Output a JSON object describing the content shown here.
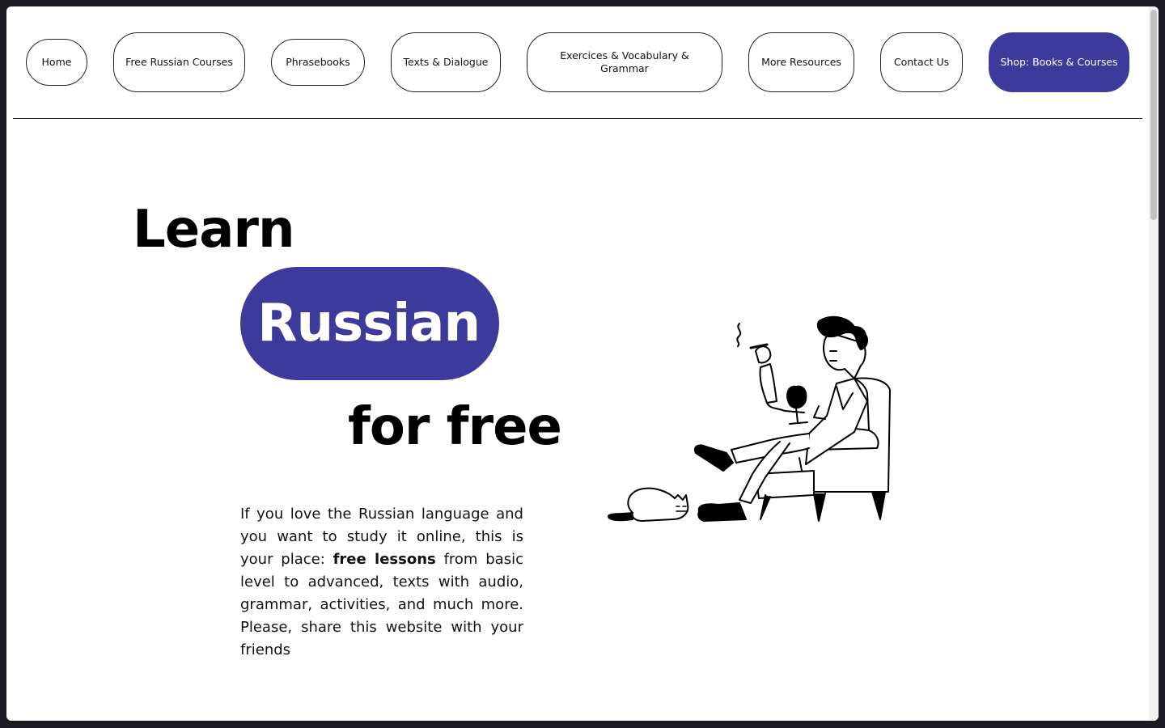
{
  "nav": {
    "items": [
      {
        "label": "Home"
      },
      {
        "label": "Free Russian Courses"
      },
      {
        "label": "Phrasebooks"
      },
      {
        "label": "Texts & Dialogue"
      },
      {
        "label": "Exercices & Vocabulary & Grammar"
      },
      {
        "label": "More Resources"
      },
      {
        "label": "Contact Us"
      },
      {
        "label": "Shop: Books & Courses"
      }
    ]
  },
  "hero": {
    "line1": "Learn",
    "line2": "Russian",
    "line3": "for free"
  },
  "intro": {
    "part1": "If you love the Russian language and you want to study it online, this is your place: ",
    "bold": "free lessons",
    "part2": " from basic level to advanced, texts with audio, grammar, activities, and much more. Please, share this website with your friends"
  },
  "colors": {
    "accent": "#3c3b9b",
    "background": "#ffffff",
    "frame": "#1c1a22",
    "text": "#000000"
  },
  "icons": {
    "illustration": "man-in-armchair-with-cat-illustration"
  }
}
